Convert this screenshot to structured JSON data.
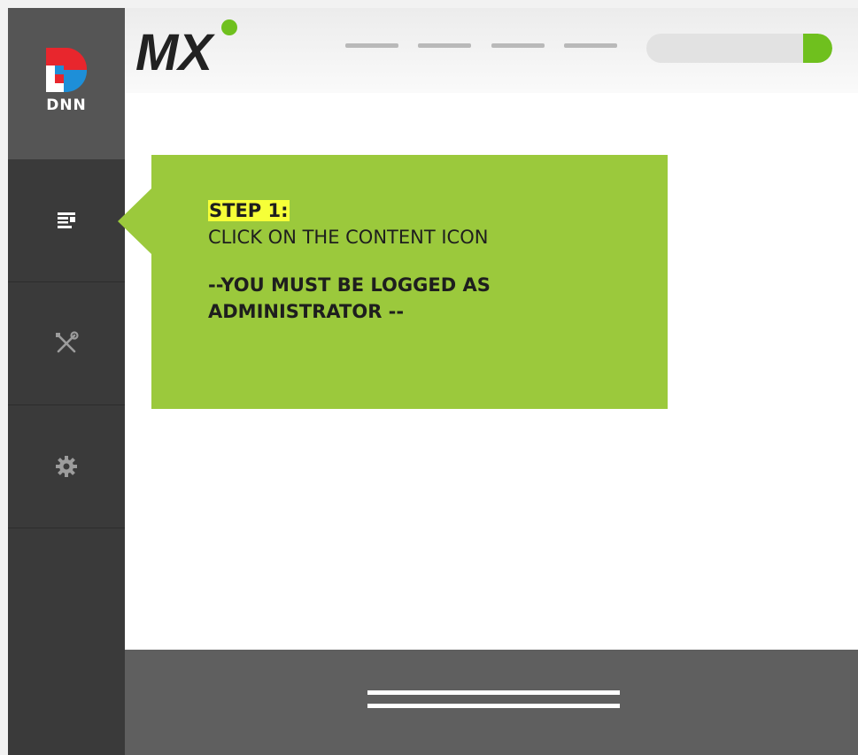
{
  "sidebar": {
    "logo_text": "DNN",
    "items": [
      {
        "name": "content",
        "icon": "content-icon"
      },
      {
        "name": "tools",
        "icon": "tools-icon"
      },
      {
        "name": "settings",
        "icon": "gear-icon"
      }
    ]
  },
  "header": {
    "logo_text": "MX",
    "search_button_color": "#6fc01e"
  },
  "callout": {
    "step_label": "STEP 1:",
    "instruction": "CLICK ON THE CONTENT ICON",
    "warning": "--YOU MUST BE LOGGED AS ADMINISTRATOR --",
    "background_color": "#9bc93c",
    "highlight_color": "#f6ff38"
  }
}
